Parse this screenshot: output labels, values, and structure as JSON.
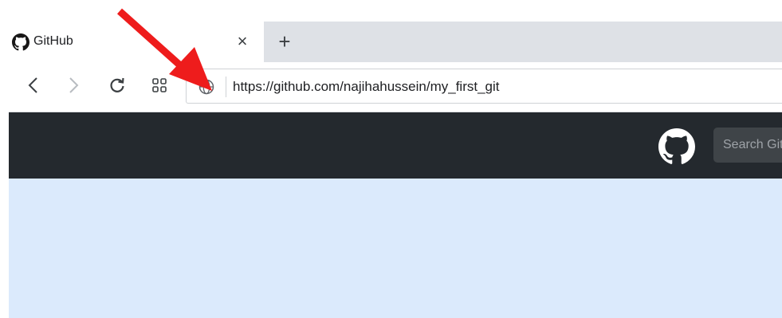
{
  "tab": {
    "title": "GitHub",
    "close_glyph": "×",
    "favicon": "github-icon"
  },
  "tabstrip": {
    "new_tab_glyph": "+"
  },
  "toolbar": {
    "back_icon": "chevron-left-icon",
    "forward_icon": "chevron-right-icon",
    "reload_icon": "reload-icon",
    "apps_icon": "apps-grid-icon"
  },
  "omnibox": {
    "site_icon": "globe-icon",
    "url": "https://github.com/najihahussein/my_first_git"
  },
  "github_header": {
    "logo": "github-mark-icon",
    "search_placeholder": "Search GitHub"
  },
  "annotation": {
    "arrow_color": "#ee1c1c",
    "points_to": "globe-icon"
  },
  "colors": {
    "header_bg": "#24292e",
    "page_bg": "#dbeafc",
    "tabstrip_bg": "#dee1e6"
  }
}
